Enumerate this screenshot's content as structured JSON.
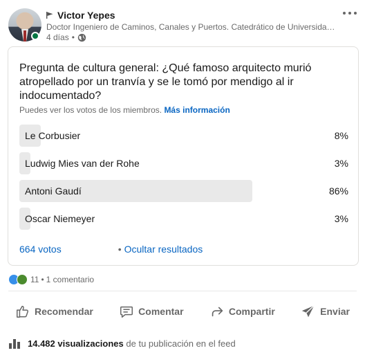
{
  "author": {
    "name": "Victor Yepes",
    "headline": "Doctor Ingeniero de Caminos, Canales y Puertos. Catedrático de Universidad ...",
    "time_ago": "4 días",
    "separator": "•"
  },
  "poll": {
    "question": "Pregunta de cultura general: ¿Qué famoso arquitecto murió atropellado por un tranvía y se le tomó por mendigo al ir indocumentado?",
    "visibility_text": "Puedes ver los votos de los miembros.",
    "more_info_link": "Más información",
    "options": [
      {
        "label": "Le Corbusier",
        "percent_label": "8%",
        "share": 0.08
      },
      {
        "label": "Ludwig Mies van der Rohe",
        "percent_label": "3%",
        "share": 0.03
      },
      {
        "label": "Antoni Gaudí",
        "percent_label": "86%",
        "share": 0.86
      },
      {
        "label": "Oscar Niemeyer",
        "percent_label": "3%",
        "share": 0.03
      }
    ],
    "votes_label": "664 votos",
    "footer_dot": "•",
    "hide_results_label": "Ocultar resultados"
  },
  "social": {
    "reactions_count": "11",
    "separator": "•",
    "comments_label": "1 comentario"
  },
  "actions": [
    {
      "label": "Recomendar",
      "icon": "like-icon"
    },
    {
      "label": "Comentar",
      "icon": "comment-icon"
    },
    {
      "label": "Compartir",
      "icon": "share-icon"
    },
    {
      "label": "Enviar",
      "icon": "send-icon"
    }
  ],
  "views": {
    "count": "14.482 visualizaciones",
    "rest": "de tu publicación en el feed"
  },
  "colors": {
    "link": "#0a66c2",
    "bar_fill": "#e9e9e9",
    "online": "#057642"
  }
}
